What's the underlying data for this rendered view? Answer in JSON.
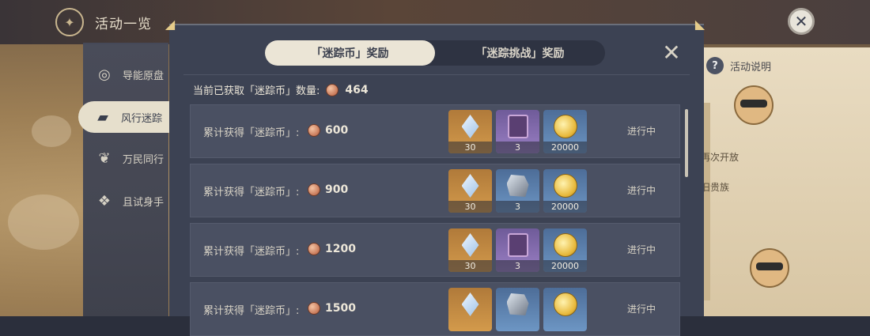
{
  "header": {
    "title": "活动一览"
  },
  "sidebar": {
    "items": [
      {
        "label": "导能原盘"
      },
      {
        "label": "风行迷踪"
      },
      {
        "label": "万民同行"
      },
      {
        "label": "且试身手"
      }
    ]
  },
  "help": {
    "label": "活动说明"
  },
  "right_card": {
    "line1": "再次开放",
    "line2": "旧贵族"
  },
  "modal": {
    "tabs": [
      {
        "label": "「迷踪币」奖励"
      },
      {
        "label": "「迷踪挑战」奖励"
      }
    ],
    "count_label": "当前已获取「迷踪币」数量:",
    "count_value": "464",
    "rows": [
      {
        "label": "累计获得「迷踪币」:",
        "target": "600",
        "rewards": [
          {
            "icon": "primogem-icon",
            "count": "30"
          },
          {
            "icon": "hero-wit-book-icon",
            "count": "3"
          },
          {
            "icon": "mora-icon",
            "count": "20000"
          }
        ],
        "status": "进行中"
      },
      {
        "label": "累计获得「迷踪币」:",
        "target": "900",
        "rewards": [
          {
            "icon": "primogem-icon",
            "count": "30"
          },
          {
            "icon": "mystic-ore-icon",
            "count": "3"
          },
          {
            "icon": "mora-icon",
            "count": "20000"
          }
        ],
        "status": "进行中"
      },
      {
        "label": "累计获得「迷踪币」:",
        "target": "1200",
        "rewards": [
          {
            "icon": "primogem-icon",
            "count": "30"
          },
          {
            "icon": "hero-wit-book-icon",
            "count": "3"
          },
          {
            "icon": "mora-icon",
            "count": "20000"
          }
        ],
        "status": "进行中"
      },
      {
        "label": "累计获得「迷踪币」:",
        "target": "1500",
        "rewards": [
          {
            "icon": "primogem-icon",
            "count": ""
          },
          {
            "icon": "mystic-ore-icon",
            "count": ""
          },
          {
            "icon": "mora-icon",
            "count": ""
          }
        ],
        "status": "进行中"
      }
    ]
  }
}
